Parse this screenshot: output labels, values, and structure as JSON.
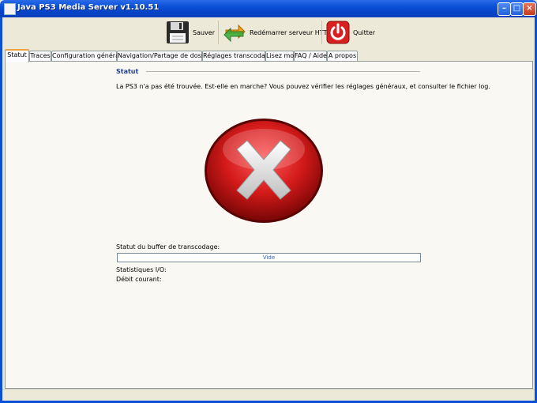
{
  "window": {
    "title": "Java PS3 Media Server v1.10.51",
    "controls": [
      "minimize",
      "maximize",
      "close"
    ]
  },
  "toolbar": {
    "save_label": "Sauver",
    "restart_label": "Redémarrer serveur HTTP",
    "quit_label": "Quitter"
  },
  "tabs": [
    {
      "label": "Statut",
      "active": true
    },
    {
      "label": "Traces"
    },
    {
      "label": "Configuration générale"
    },
    {
      "label": "Navigation/Partage de dossiers"
    },
    {
      "label": "Réglages transcodage"
    },
    {
      "label": "Lisez moi"
    },
    {
      "label": "FAQ / Aide"
    },
    {
      "label": "A propos"
    }
  ],
  "status": {
    "section_title": "Statut",
    "message": "La PS3 n'a pas été trouvée. Est-elle en marche? Vous pouvez vérifier les réglages généraux, et consulter le fichier log.",
    "buffer_label": "Statut du buffer de transcodage:",
    "buffer_value": "Vide",
    "buffer_level": 0,
    "io_label": "Statistiques I/O:",
    "rate_label": "Débit courant:"
  },
  "icons": {
    "app": "app-icon",
    "save": "floppy-disk-icon",
    "restart": "refresh-arrows-icon",
    "quit": "power-icon",
    "status": "error-x-icon"
  },
  "colors": {
    "titlebar": "#0a4fd6",
    "section_title": "#1f3f8f",
    "error_red": "#d41a1a",
    "active_tab": "#f1a23b"
  }
}
